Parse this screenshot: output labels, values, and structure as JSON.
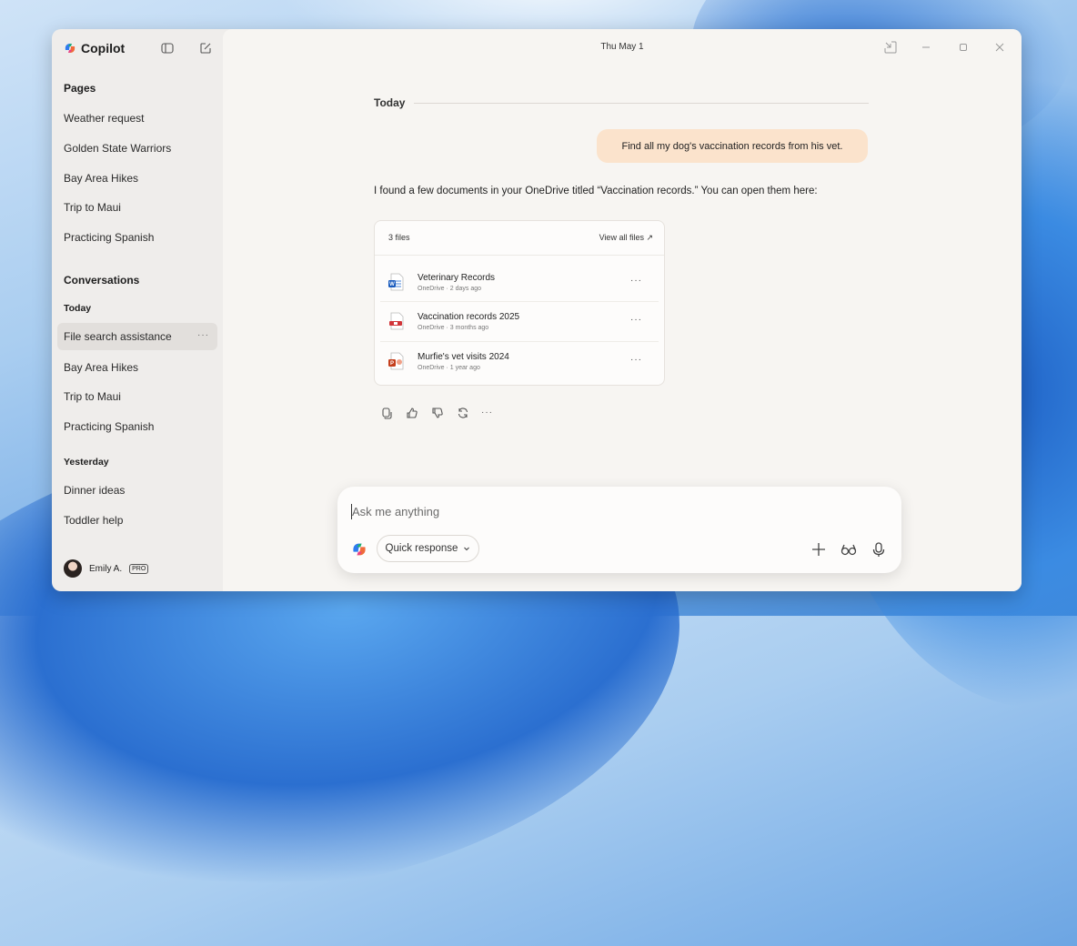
{
  "app": {
    "name": "Copilot"
  },
  "header": {
    "date": "Thu May 1"
  },
  "sidebar": {
    "pages_title": "Pages",
    "pages": [
      "Weather request",
      "Golden State Warriors",
      "Bay Area Hikes",
      "Trip to Maui",
      "Practicing Spanish"
    ],
    "conversations_title": "Conversations",
    "today_label": "Today",
    "today_items": [
      "File search assistance",
      "Bay Area Hikes",
      "Trip to Maui",
      "Practicing Spanish"
    ],
    "active_more": "···",
    "yesterday_label": "Yesterday",
    "yesterday_items": [
      "Dinner ideas",
      "Toddler help"
    ],
    "user": {
      "name": "Emily A.",
      "badge": "PRO"
    }
  },
  "chat": {
    "day_header": "Today",
    "user_message": "Find all my dog's vaccination records from his vet.",
    "assistant_reply": "I found a few documents in your OneDrive titled “Vaccination records.” You can open them here:",
    "files_card": {
      "count_label": "3 files",
      "view_all_label": "View all files ↗",
      "files": [
        {
          "name": "Veterinary Records",
          "meta": "OneDrive · 2 days ago",
          "type": "word",
          "color": "#185abd"
        },
        {
          "name": "Vaccination records 2025",
          "meta": "OneDrive · 3 months ago",
          "type": "pdf",
          "color": "#d13438"
        },
        {
          "name": "Murfie's vet visits 2024",
          "meta": "OneDrive · 1 year ago",
          "type": "powerpoint",
          "color": "#c43e1c"
        }
      ],
      "more": "···"
    },
    "action_icons": [
      "copy-icon",
      "thumbs-up-icon",
      "thumbs-down-icon",
      "refresh-icon",
      "more-icon"
    ],
    "more_label": "···"
  },
  "composer": {
    "placeholder": "Ask me anything",
    "mode_label": "Quick response",
    "icons": [
      "plus-icon",
      "vision-glasses-icon",
      "microphone-icon"
    ]
  },
  "colors": {
    "sidebar_bg": "#efedeb",
    "main_bg": "#f7f5f2",
    "user_bubble": "#fbe3cc"
  }
}
